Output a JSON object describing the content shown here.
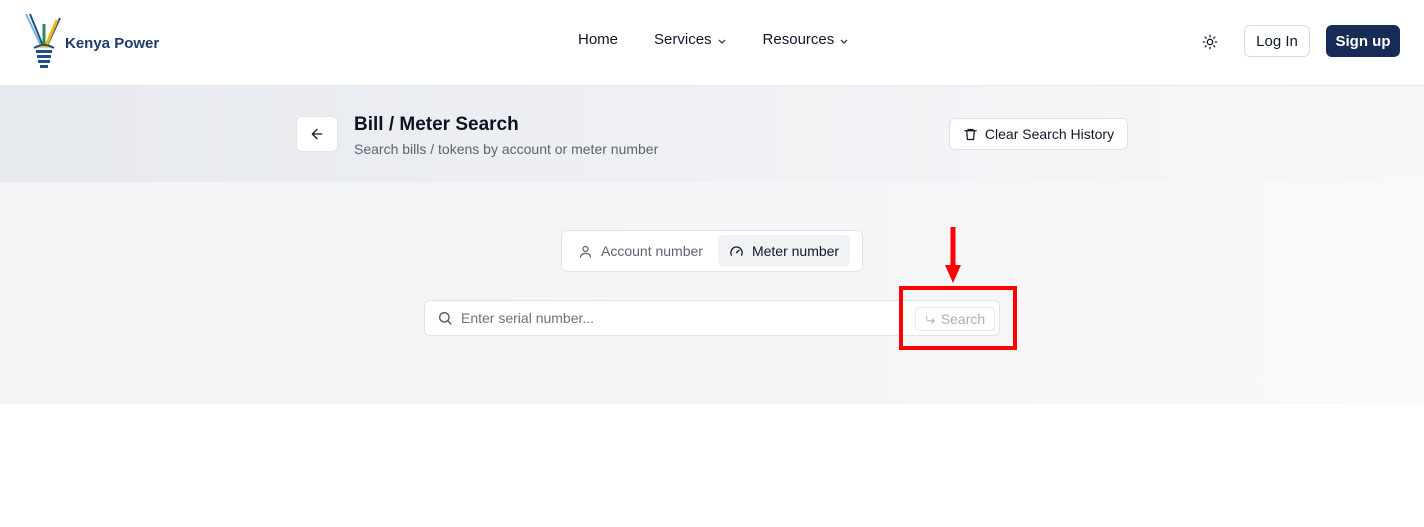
{
  "brand": {
    "name": "Kenya Power"
  },
  "nav": {
    "items": [
      {
        "label": "Home",
        "has_dropdown": false
      },
      {
        "label": "Services",
        "has_dropdown": true
      },
      {
        "label": "Resources",
        "has_dropdown": true
      }
    ],
    "chevron": "⌄"
  },
  "header": {
    "theme_icon": "sun-icon",
    "login_label": "Log In",
    "signup_label": "Sign up"
  },
  "page": {
    "title": "Bill / Meter Search",
    "subtitle": "Search bills / tokens by account or meter number",
    "clear_history_label": "Clear Search History"
  },
  "search": {
    "tabs": [
      {
        "label": "Account number",
        "icon": "user-icon",
        "active": false
      },
      {
        "label": "Meter number",
        "icon": "gauge-icon",
        "active": true
      }
    ],
    "placeholder": "Enter serial number...",
    "value": "",
    "button_label": "Search",
    "button_icon": "corner-down-right-icon"
  },
  "colors": {
    "brand_navy": "#162c57",
    "annotation_red": "#ff0000",
    "muted_text": "#5b6472"
  }
}
